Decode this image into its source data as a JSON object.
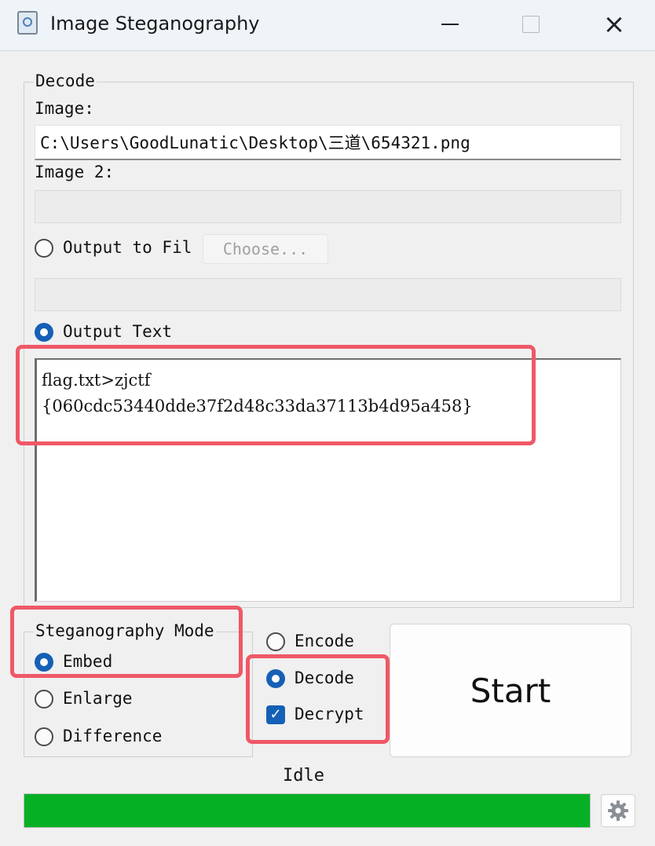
{
  "window": {
    "title": "Image Steganography",
    "app_icon": "document-icon",
    "controls": {
      "minimize": "minimize-icon",
      "maximize": "maximize-icon",
      "close": "×"
    }
  },
  "decode_group": {
    "legend": "Decode",
    "image_label": "Image:",
    "image_path": "C:\\Users\\GoodLunatic\\Desktop\\三道\\654321.png",
    "image2_label": "Image 2:",
    "image2_path": "",
    "output_to_file_label": "Output to Fil",
    "output_to_file_selected": false,
    "choose_button": "Choose...",
    "output_file_path": "",
    "output_text_label": "Output Text",
    "output_text_selected": true,
    "output_text": "flag.txt>zjctf\n{060cdc53440dde37f2d48c33da37113b4d95a458}"
  },
  "mode_group": {
    "legend": "Steganography Mode",
    "options": [
      {
        "label": "Embed",
        "selected": true
      },
      {
        "label": "Enlarge",
        "selected": false
      },
      {
        "label": "Difference",
        "selected": false
      }
    ]
  },
  "operation": {
    "encode_label": "Encode",
    "encode_selected": false,
    "decode_label": "Decode",
    "decode_selected": true,
    "decrypt_label": "Decrypt",
    "decrypt_checked": true
  },
  "start_button": "Start",
  "status": {
    "text": "Idle",
    "progress": 1.0,
    "progress_color": "#06b025"
  },
  "settings_icon": "gear-icon",
  "colors": {
    "accent": "#1560b6",
    "highlight": "#ef5866"
  }
}
